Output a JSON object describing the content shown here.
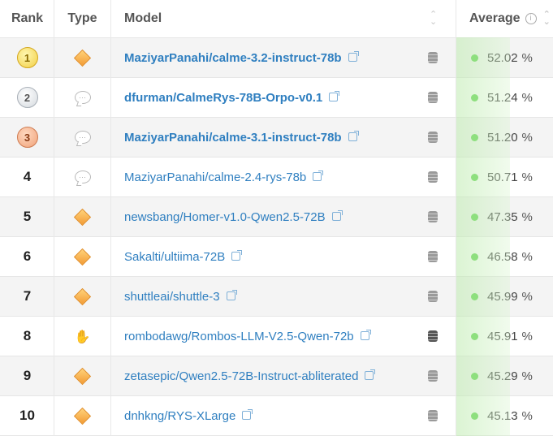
{
  "header": {
    "rank": "Rank",
    "type": "Type",
    "model": "Model",
    "average": "Average",
    "info_glyph": "i"
  },
  "colors": {
    "link": "#2f7fc0",
    "status_dot": "#5bd24a",
    "accent_band": "#d7f5cd"
  },
  "rows": [
    {
      "rank": "1",
      "type_icon": "diamond-icon",
      "model": "MaziyarPanahi/calme-3.2-instruct-78b",
      "average": "52.02",
      "unit": "%"
    },
    {
      "rank": "2",
      "type_icon": "chat-icon",
      "model": "dfurman/CalmeRys-78B-Orpo-v0.1",
      "average": "51.24",
      "unit": "%"
    },
    {
      "rank": "3",
      "type_icon": "chat-icon",
      "model": "MaziyarPanahi/calme-3.1-instruct-78b",
      "average": "51.20",
      "unit": "%"
    },
    {
      "rank": "4",
      "type_icon": "chat-icon",
      "model": "MaziyarPanahi/calme-2.4-rys-78b",
      "average": "50.71",
      "unit": "%"
    },
    {
      "rank": "5",
      "type_icon": "diamond-icon",
      "model": "newsbang/Homer-v1.0-Qwen2.5-72B",
      "average": "47.35",
      "unit": "%"
    },
    {
      "rank": "6",
      "type_icon": "diamond-icon",
      "model": "Sakalti/ultiima-72B",
      "average": "46.58",
      "unit": "%"
    },
    {
      "rank": "7",
      "type_icon": "diamond-icon",
      "model": "shuttleai/shuttle-3",
      "average": "45.99",
      "unit": "%"
    },
    {
      "rank": "8",
      "type_icon": "handshake-icon",
      "model": "rombodawg/Rombos-LLM-V2.5-Qwen-72b",
      "average": "45.91",
      "unit": "%"
    },
    {
      "rank": "9",
      "type_icon": "diamond-icon",
      "model": "zetasepic/Qwen2.5-72B-Instruct-abliterated",
      "average": "45.29",
      "unit": "%"
    },
    {
      "rank": "10",
      "type_icon": "diamond-icon",
      "model": "dnhkng/RYS-XLarge",
      "average": "45.13",
      "unit": "%"
    }
  ]
}
